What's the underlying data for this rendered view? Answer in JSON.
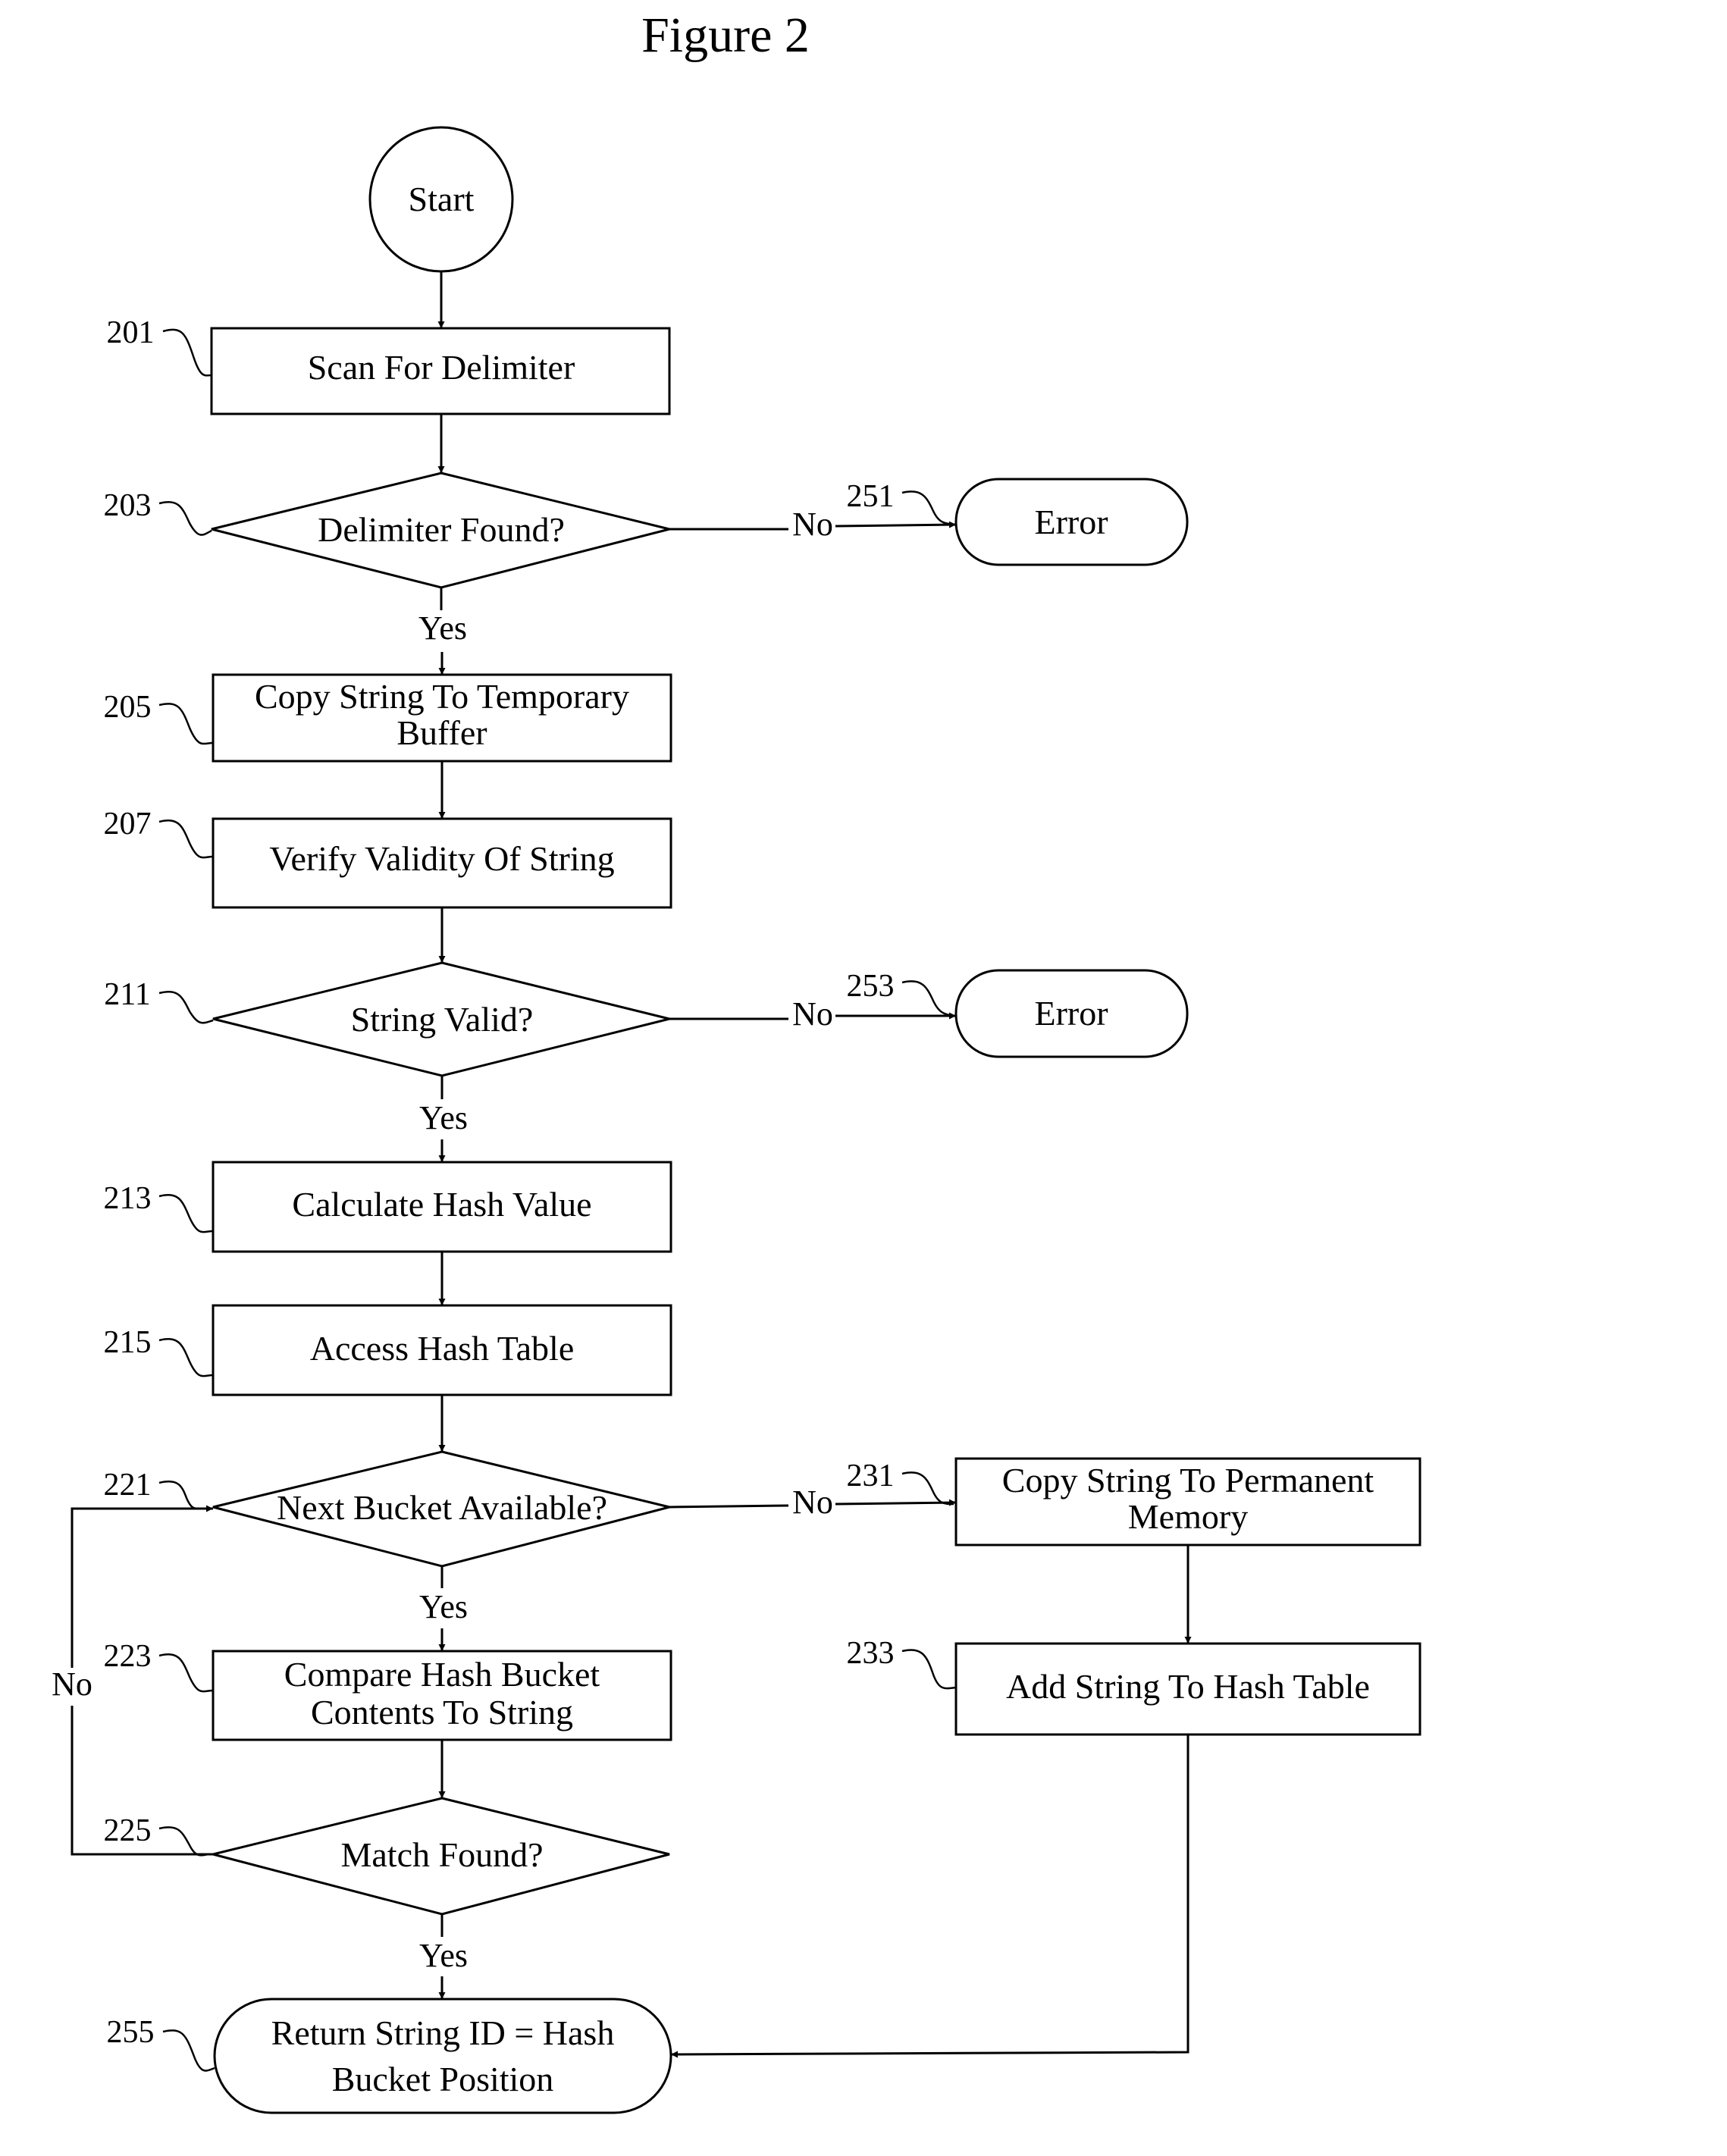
{
  "title": "Figure 2",
  "nodes": {
    "start": {
      "label": "Start",
      "type": "start"
    },
    "n201": {
      "ref": "201",
      "lines": [
        "Scan For Delimiter"
      ],
      "type": "process"
    },
    "n203": {
      "ref": "203",
      "lines": [
        "Delimiter Found?"
      ],
      "type": "decision"
    },
    "n251": {
      "ref": "251",
      "lines": [
        "Error"
      ],
      "type": "terminal"
    },
    "n205": {
      "ref": "205",
      "lines": [
        "Copy String To Temporary",
        "Buffer"
      ],
      "type": "process"
    },
    "n207": {
      "ref": "207",
      "lines": [
        "Verify Validity Of String"
      ],
      "type": "process"
    },
    "n211": {
      "ref": "211",
      "lines": [
        "String Valid?"
      ],
      "type": "decision"
    },
    "n253": {
      "ref": "253",
      "lines": [
        "Error"
      ],
      "type": "terminal"
    },
    "n213": {
      "ref": "213",
      "lines": [
        "Calculate Hash Value"
      ],
      "type": "process"
    },
    "n215": {
      "ref": "215",
      "lines": [
        "Access Hash Table"
      ],
      "type": "process"
    },
    "n221": {
      "ref": "221",
      "lines": [
        "Next Bucket Available?"
      ],
      "type": "decision"
    },
    "n231": {
      "ref": "231",
      "lines": [
        "Copy String To Permanent",
        "Memory"
      ],
      "type": "process"
    },
    "n233": {
      "ref": "233",
      "lines": [
        "Add String To Hash Table"
      ],
      "type": "process"
    },
    "n223": {
      "ref": "223",
      "lines": [
        "Compare Hash Bucket",
        "Contents To String"
      ],
      "type": "process"
    },
    "n225": {
      "ref": "225",
      "lines": [
        "Match Found?"
      ],
      "type": "decision"
    },
    "n255": {
      "ref": "255",
      "lines": [
        "Return String ID = Hash",
        "Bucket Position"
      ],
      "type": "terminal"
    }
  },
  "edges": [
    {
      "from": "start",
      "to": "n201",
      "label": ""
    },
    {
      "from": "n201",
      "to": "n203",
      "label": ""
    },
    {
      "from": "n203",
      "to": "n251",
      "label": "No"
    },
    {
      "from": "n203",
      "to": "n205",
      "label": "Yes"
    },
    {
      "from": "n205",
      "to": "n207",
      "label": ""
    },
    {
      "from": "n207",
      "to": "n211",
      "label": ""
    },
    {
      "from": "n211",
      "to": "n253",
      "label": "No"
    },
    {
      "from": "n211",
      "to": "n213",
      "label": "Yes"
    },
    {
      "from": "n213",
      "to": "n215",
      "label": ""
    },
    {
      "from": "n215",
      "to": "n221",
      "label": ""
    },
    {
      "from": "n221",
      "to": "n231",
      "label": "No"
    },
    {
      "from": "n221",
      "to": "n223",
      "label": "Yes"
    },
    {
      "from": "n231",
      "to": "n233",
      "label": ""
    },
    {
      "from": "n233",
      "to": "n255",
      "label": ""
    },
    {
      "from": "n223",
      "to": "n225",
      "label": ""
    },
    {
      "from": "n225",
      "to": "n221",
      "label": "No"
    },
    {
      "from": "n225",
      "to": "n255",
      "label": "Yes"
    }
  ],
  "edge_labels": {
    "e203_no": "No",
    "e203_yes": "Yes",
    "e211_no": "No",
    "e211_yes": "Yes",
    "e221_no": "No",
    "e221_yes": "Yes",
    "e225_no": "No",
    "e225_yes": "Yes"
  }
}
